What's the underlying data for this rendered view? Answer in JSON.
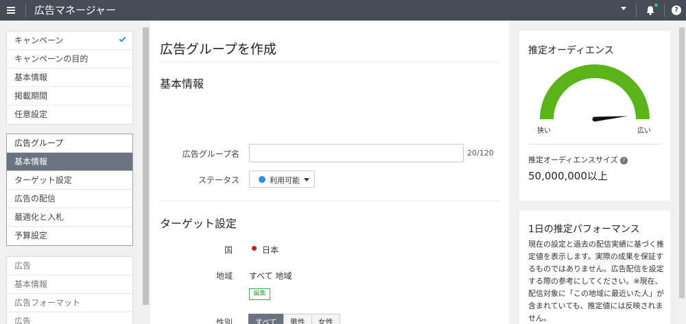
{
  "header": {
    "title": "広告マネージャー"
  },
  "sidebar": {
    "campaign_group": [
      {
        "label": "キャンペーン",
        "checked": true
      },
      {
        "label": "キャンペーンの目的"
      },
      {
        "label": "基本情報"
      },
      {
        "label": "掲載期間"
      },
      {
        "label": "任意設定"
      }
    ],
    "adgroup_group": [
      {
        "label": "広告グループ"
      },
      {
        "label": "基本情報",
        "active": true
      },
      {
        "label": "ターゲット設定"
      },
      {
        "label": "広告の配信"
      },
      {
        "label": "最適化と入札"
      },
      {
        "label": "予算設定"
      }
    ],
    "ad_group": [
      {
        "label": "広告"
      },
      {
        "label": "基本情報"
      },
      {
        "label": "広告フォーマット"
      },
      {
        "label": "広告"
      }
    ]
  },
  "main": {
    "page_title": "広告グループを作成",
    "basic_info_heading": "基本情報",
    "adgroup_name_label": "広告グループ名",
    "adgroup_name_value": "",
    "adgroup_name_counter": "20/120",
    "status_label": "ステータス",
    "status_value": "利用可能",
    "status_color": "#2e8ce6",
    "targeting_heading": "ターゲット設定",
    "country_label": "国",
    "country_value": "日本",
    "region_label": "地域",
    "region_value": "すべて 地域",
    "edit_label": "編集",
    "gender_label": "性別",
    "gender_options": [
      "すべて",
      "男性",
      "女性"
    ],
    "gender_selected": "すべて"
  },
  "audience_card": {
    "title": "推定オーディエンス",
    "gauge_min_label": "狭い",
    "gauge_max_label": "広い",
    "gauge_level": 0.97,
    "gauge_color": "#5bb31a",
    "size_label": "推定オーディエンスサイズ",
    "size_value": "50,000,000以上"
  },
  "performance_card": {
    "title": "1日の推定パフォーマンス",
    "description": "現在の設定と過去の配信実績に基づく推定値を表示します。実際の成果を保証するものではありません。広告配信を設定する際の参考にしてください。※現在、配信対象に「この地域に最近いた人」が含まれていても、推定値には反映されません。"
  }
}
